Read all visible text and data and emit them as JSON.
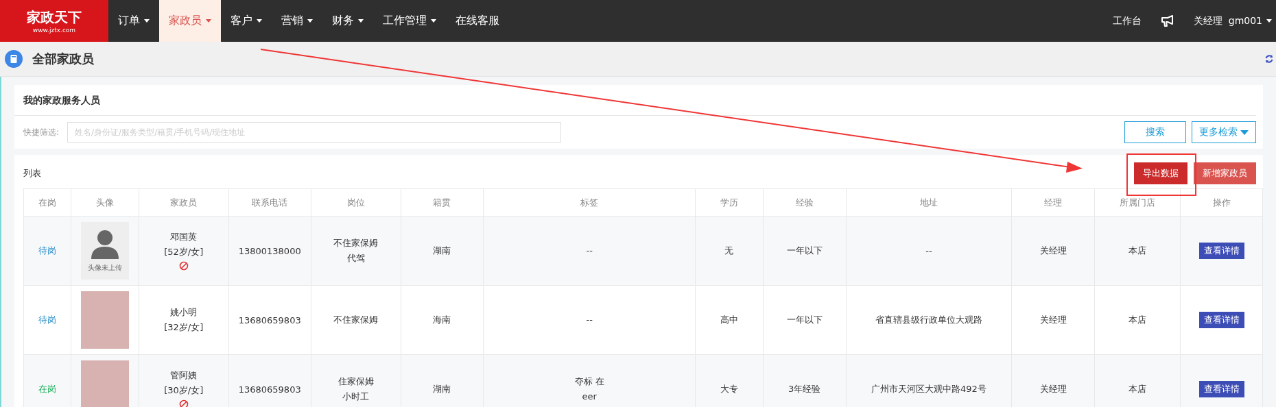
{
  "nav": {
    "logo_text": "家政天下",
    "logo_url": "www.jztx.com",
    "items": [
      {
        "label": "订单",
        "dropdown": true,
        "selected": false
      },
      {
        "label": "家政员",
        "dropdown": true,
        "selected": true
      },
      {
        "label": "客户",
        "dropdown": true,
        "selected": false
      },
      {
        "label": "营销",
        "dropdown": true,
        "selected": false
      },
      {
        "label": "财务",
        "dropdown": true,
        "selected": false
      },
      {
        "label": "工作管理",
        "dropdown": true,
        "selected": false
      },
      {
        "label": "在线客服",
        "dropdown": false,
        "selected": false
      }
    ],
    "workbench": "工作台",
    "user_role": "关经理",
    "user_id": "gm001"
  },
  "page_title": "全部家政员",
  "filter_panel": {
    "title": "我的家政服务人员",
    "label": "快捷筛选:",
    "placeholder": "姓名/身份证/服务类型/籍贯/手机号码/现住地址",
    "search_button": "搜索",
    "more_button": "更多检索"
  },
  "list_panel": {
    "title": "列表",
    "export_button": "导出数据",
    "add_button": "新增家政员"
  },
  "table": {
    "columns": [
      "在岗",
      "头像",
      "家政员",
      "联系电话",
      "岗位",
      "籍贯",
      "标签",
      "学历",
      "经验",
      "地址",
      "经理",
      "所属门店",
      "操作"
    ],
    "rows": [
      {
        "status": "待岗",
        "color": "#2a8fc8",
        "avatar": {
          "kind": "default",
          "caption": "头像未上传"
        },
        "name": "邓国英",
        "info": "[52岁/女]",
        "blocked": true,
        "phone": "13800138000",
        "positions": [
          "不住家保姆",
          "代驾"
        ],
        "origin": "湖南",
        "tags": [
          "--"
        ],
        "education": "无",
        "experience": "一年以下",
        "address": "--",
        "manager": "关经理",
        "store": "本店",
        "action": "查看详情"
      },
      {
        "status": "待岗",
        "color": "#2a8fc8",
        "avatar": {
          "kind": "photo"
        },
        "name": "姚小明",
        "info": "[32岁/女]",
        "blocked": false,
        "phone": "13680659803",
        "positions": [
          "不住家保姆"
        ],
        "origin": "海南",
        "tags": [
          "--"
        ],
        "education": "高中",
        "experience": "一年以下",
        "address": "省直辖县级行政单位大观路",
        "manager": "关经理",
        "store": "本店",
        "action": "查看详情"
      },
      {
        "status": "在岗",
        "color": "#1bb05a",
        "avatar": {
          "kind": "photo"
        },
        "name": "管阿姨",
        "info": "[30岁/女]",
        "blocked": true,
        "phone": "13680659803",
        "positions": [
          "住家保姆",
          "小时工"
        ],
        "origin": "湖南",
        "tags": [
          "夺标 在",
          "eer"
        ],
        "education": "大专",
        "experience": "3年经验",
        "address": "广州市天河区大观中路492号",
        "manager": "关经理",
        "store": "本店",
        "action": "查看详情"
      }
    ]
  },
  "annotation": {
    "highlight": true,
    "arrow": true
  }
}
